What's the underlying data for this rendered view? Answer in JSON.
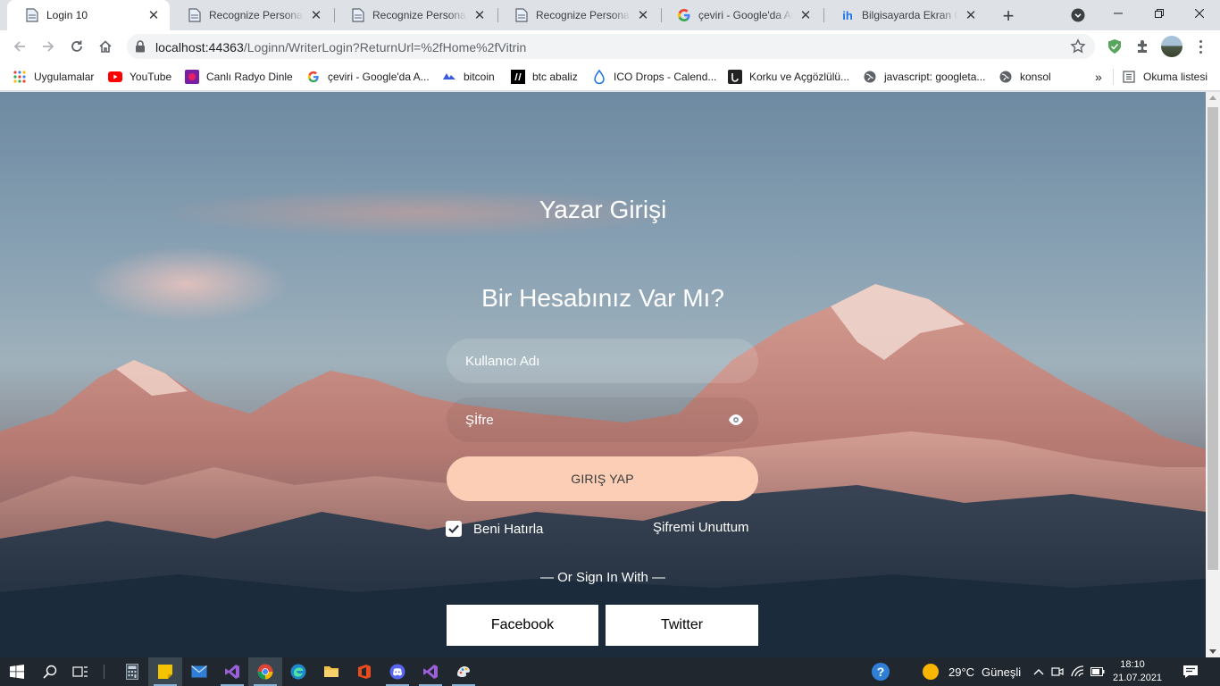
{
  "browser": {
    "tabs": [
      {
        "title": "Login 10",
        "icon": "page-icon",
        "active": true
      },
      {
        "title": "Recognize Personal Ca",
        "icon": "page-icon",
        "active": false
      },
      {
        "title": "Recognize Personal Ca",
        "icon": "page-icon",
        "active": false
      },
      {
        "title": "Recognize Personal Ca",
        "icon": "page-icon",
        "active": false
      },
      {
        "title": "çeviri - Google'da Ara",
        "icon": "google-icon",
        "active": false
      },
      {
        "title": "Bilgisayarda Ekran Gör",
        "icon": "ih-icon",
        "active": false
      }
    ],
    "url_host": "localhost:44363",
    "url_path": "/Loginn/WriterLogin?ReturnUrl=%2fHome%2fVitrin",
    "bookmarks": [
      {
        "label": "Uygulamalar",
        "icon": "apps-grid-icon"
      },
      {
        "label": "YouTube",
        "icon": "youtube-icon"
      },
      {
        "label": "Canlı Radyo Dinle",
        "icon": "radio-icon"
      },
      {
        "label": "çeviri - Google'da A...",
        "icon": "google-icon"
      },
      {
        "label": "bitcoin",
        "icon": "bitcoin-icon"
      },
      {
        "label": "btc abaliz",
        "icon": "tradingview-icon"
      },
      {
        "label": "ICO Drops - Calend...",
        "icon": "drop-icon"
      },
      {
        "label": "Korku ve Açgözlülü...",
        "icon": "fear-greed-icon"
      },
      {
        "label": "javascript: googleta...",
        "icon": "globe-icon"
      },
      {
        "label": "konsol",
        "icon": "globe-icon"
      }
    ],
    "more_bookmarks": "»",
    "reading_list": "Okuma listesi"
  },
  "page": {
    "title": "Yazar Girişi",
    "subtitle": "Bir Hesabınız Var Mı?",
    "username_placeholder": "Kullanıcı Adı",
    "password_placeholder": "Şİfre",
    "login_button": "GIRIŞ YAP",
    "remember_me": "Beni Hatırla",
    "remember_checked": true,
    "forgot_password": "Şifremi Unuttum",
    "or_sign_in": "— Or Sign In With —",
    "facebook": "Facebook",
    "twitter": "Twitter"
  },
  "taskbar": {
    "weather_temp": "29°C",
    "weather_desc": "Güneşli",
    "time": "18:10",
    "date": "21.07.2021"
  },
  "colors": {
    "login_button": "#fbceb5",
    "tabstrip": "#dee1e6",
    "taskbar": "#20272e"
  }
}
